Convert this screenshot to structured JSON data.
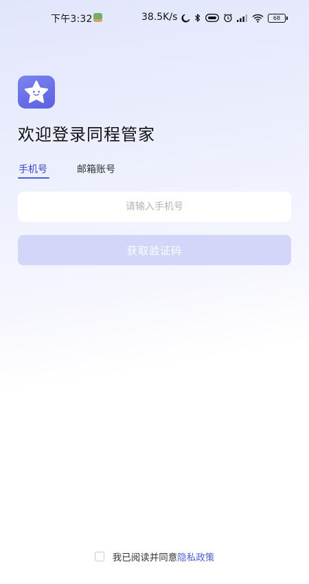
{
  "status_bar": {
    "time": "下午3:32",
    "net_speed": "38.5K/s",
    "battery_level": "68",
    "icons": [
      "moon-icon",
      "bluetooth-icon",
      "hd-icon",
      "alarm-icon",
      "signal-icon",
      "wifi-icon",
      "battery-icon"
    ]
  },
  "login": {
    "title": "欢迎登录同程管家",
    "tabs": [
      {
        "label": "手机号",
        "active": true
      },
      {
        "label": "邮箱账号",
        "active": false
      }
    ],
    "phone_input": {
      "placeholder": "请输入手机号",
      "value": ""
    },
    "get_code_label": "获取验证码"
  },
  "agreement": {
    "text": "我已阅读并同意",
    "link": "隐私政策",
    "checked": false
  },
  "colors": {
    "accent": "#4e5bd6",
    "button_disabled": "#d2d6f8",
    "logo": "#6169e6"
  }
}
